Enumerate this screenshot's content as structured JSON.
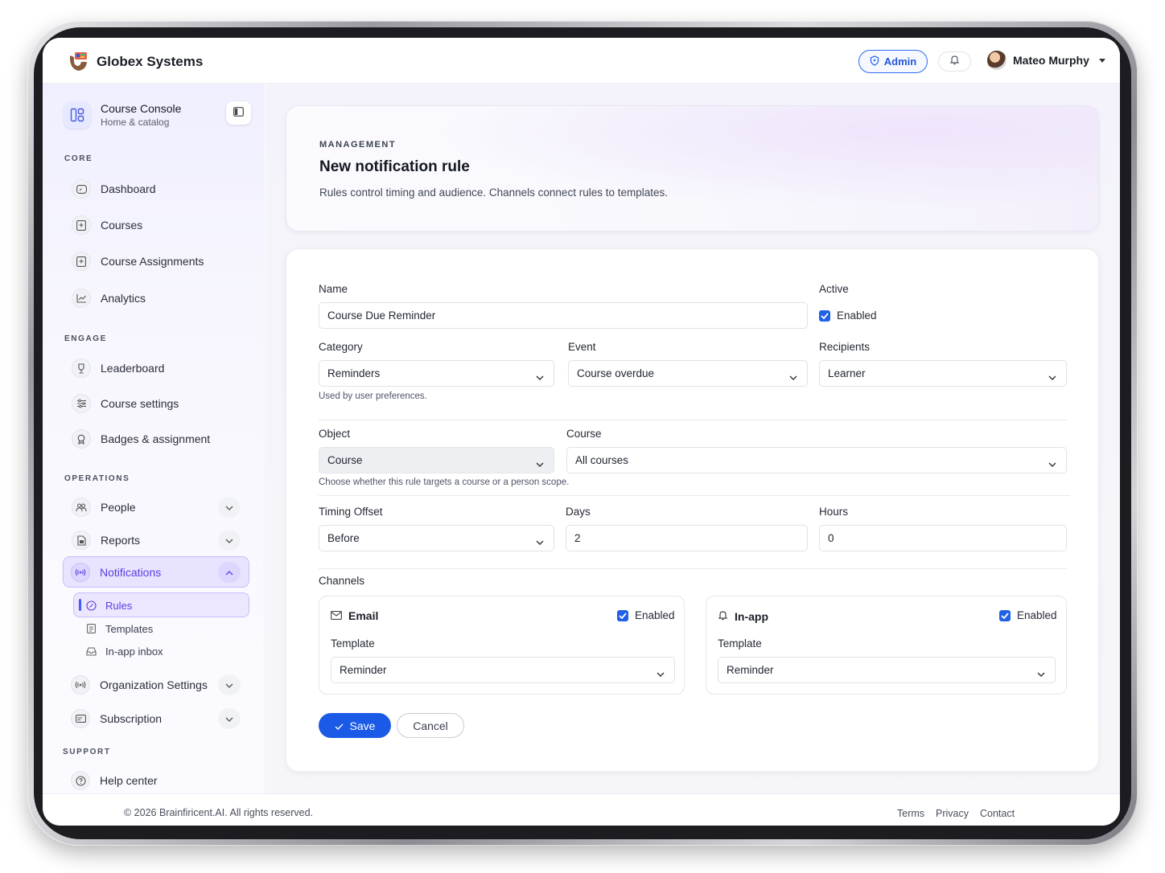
{
  "brand": {
    "name": "Globex Systems"
  },
  "header": {
    "admin_label": "Admin",
    "user_name": "Mateo Murphy"
  },
  "sidebar": {
    "console_title": "Course Console",
    "console_subtitle": "Home & catalog",
    "sections": {
      "core": "CORE",
      "engage": "ENGAGE",
      "operations": "OPERATIONS",
      "support": "SUPPORT"
    },
    "items": {
      "dashboard": "Dashboard",
      "courses": "Courses",
      "course_assignments": "Course Assignments",
      "analytics": "Analytics",
      "leaderboard": "Leaderboard",
      "course_settings": "Course settings",
      "badges": "Badges & assignment",
      "people": "People",
      "reports": "Reports",
      "notifications": "Notifications",
      "rules": "Rules",
      "templates": "Templates",
      "inapp_inbox": "In-app inbox",
      "org_settings": "Organization Settings",
      "subscription": "Subscription",
      "help_center": "Help center"
    }
  },
  "hero": {
    "eyebrow": "MANAGEMENT",
    "title": "New notification rule",
    "description": "Rules control timing and audience. Channels connect rules to templates."
  },
  "form": {
    "name_label": "Name",
    "name_value": "Course Due Reminder",
    "active_label": "Active",
    "active_text": "Enabled",
    "active_checked": true,
    "category_label": "Category",
    "category_value": "Reminders",
    "category_help": "Used by user preferences.",
    "event_label": "Event",
    "event_value": "Course overdue",
    "recipients_label": "Recipients",
    "recipients_value": "Learner",
    "object_label": "Object",
    "object_value": "Course",
    "object_help": "Choose whether this rule targets a course or a person scope.",
    "course_label": "Course",
    "course_value": "All courses",
    "timing_label": "Timing Offset",
    "timing_value": "Before",
    "days_label": "Days",
    "days_value": "2",
    "hours_label": "Hours",
    "hours_value": "0",
    "channels_label": "Channels",
    "channels": {
      "email": {
        "title": "Email",
        "enabled_text": "Enabled",
        "enabled": true,
        "template_label": "Template",
        "template_value": "Reminder"
      },
      "inapp": {
        "title": "In-app",
        "enabled_text": "Enabled",
        "enabled": true,
        "template_label": "Template",
        "template_value": "Reminder"
      }
    },
    "save_label": "Save",
    "cancel_label": "Cancel"
  },
  "footer": {
    "copyright": "© 2026 Brainfiricent.AI. All rights reserved.",
    "links": {
      "terms": "Terms",
      "privacy": "Privacy",
      "contact": "Contact"
    }
  },
  "colors": {
    "accent": "#1a5ae6",
    "active_nav_bg": "#e8e3fe",
    "active_nav_text": "#5b3ee0"
  }
}
